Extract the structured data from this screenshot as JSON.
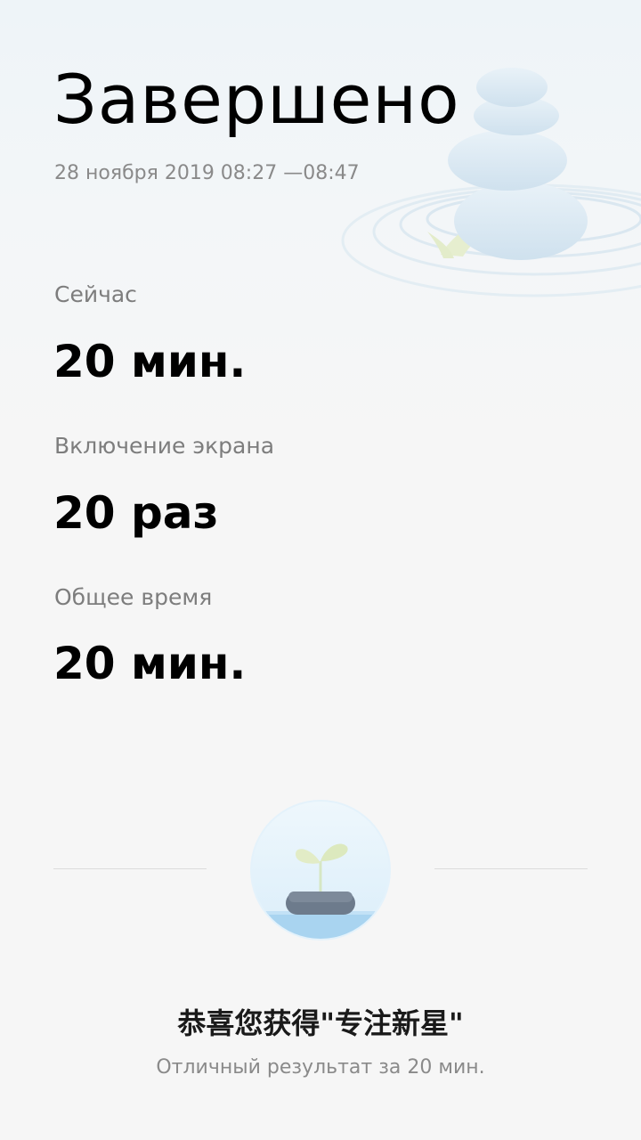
{
  "header": {
    "title": "Завершено",
    "date_range": "28 ноября 2019 08:27 —08:47"
  },
  "stats": [
    {
      "label": "Сейчас",
      "value": "20 мин."
    },
    {
      "label": "Включение экрана",
      "value": "20 раз"
    },
    {
      "label": "Общее время",
      "value": "20 мин."
    }
  ],
  "achievement": {
    "badge_icon": "sprout-on-stone-icon",
    "title": "恭喜您获得\"专注新星\"",
    "subtitle": "Отличный результат за 20 мин."
  },
  "illustration": {
    "icon": "zen-stones-icon"
  },
  "colors": {
    "background": "#f6f6f6",
    "text_primary": "#000000",
    "text_secondary": "#8a8a8a",
    "stone": "#d6e8f3",
    "water": "#a9d4f0"
  }
}
